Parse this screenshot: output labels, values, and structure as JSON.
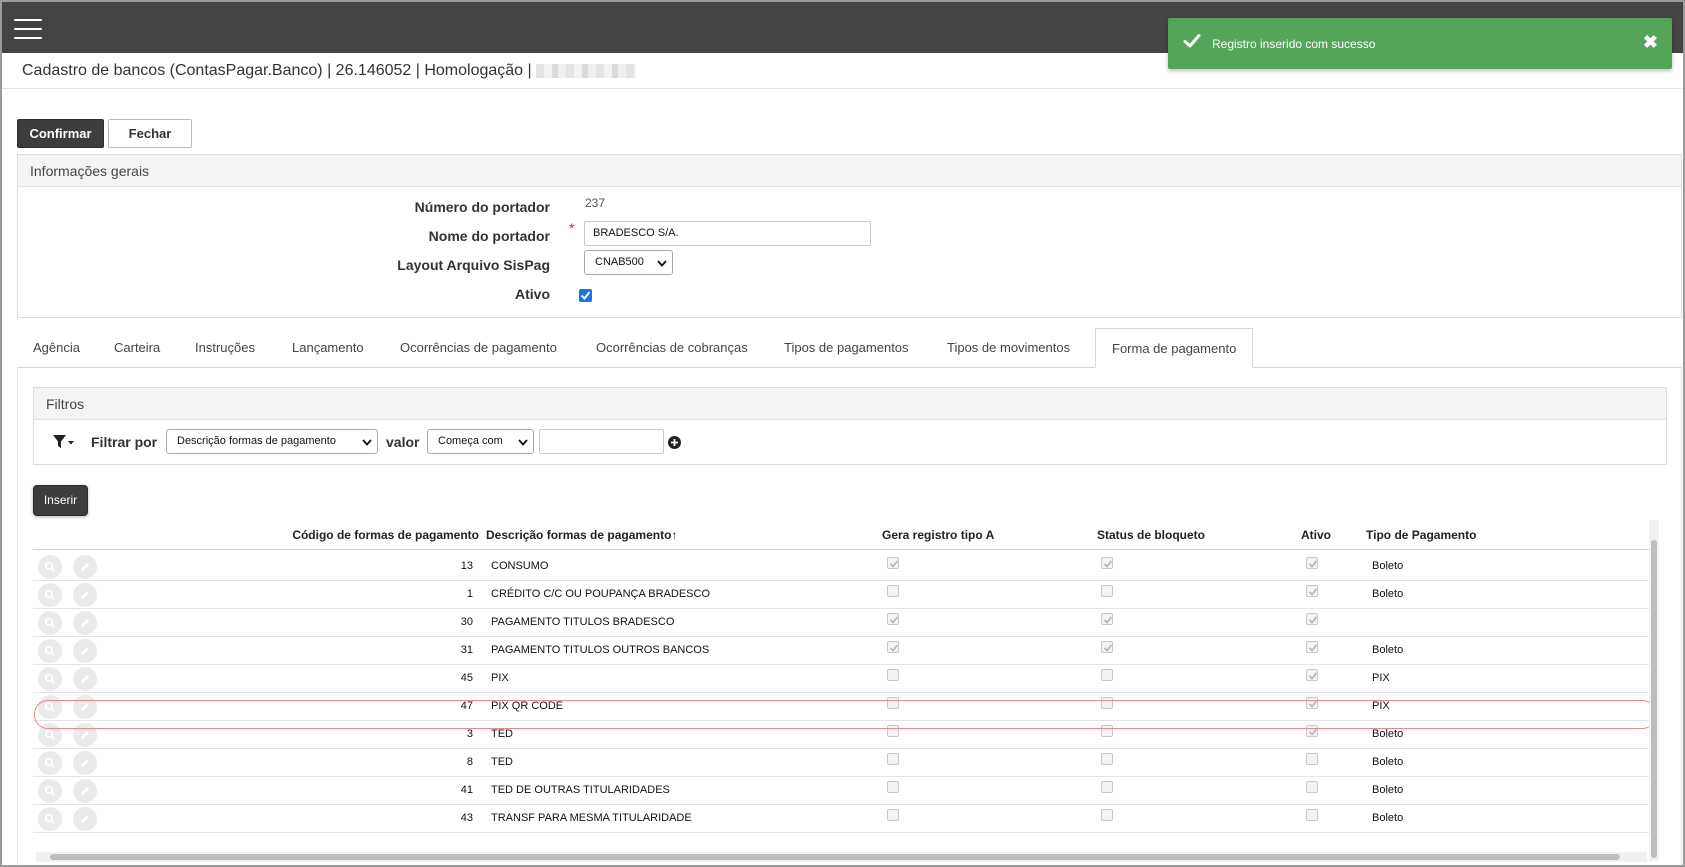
{
  "toast": {
    "message": "Registro inserido com sucesso",
    "color": "#55a558"
  },
  "header": {
    "title": "Cadastro de bancos (ContasPagar.Banco) | 26.146052 | Homologação |",
    "menu_icon": "hamburger-menu-icon"
  },
  "toolbar": {
    "confirm_label": "Confirmar",
    "close_label": "Fechar"
  },
  "general": {
    "title": "Informações gerais",
    "numero_label": "Número do portador",
    "numero_value": "237",
    "nome_label": "Nome do portador",
    "required_mark": "*",
    "nome_value": "BRADESCO S/A.",
    "layout_label": "Layout Arquivo SisPag",
    "layout_value": "CNAB500",
    "ativo_label": "Ativo",
    "ativo_checked": true
  },
  "tabs": [
    {
      "label": "Agência"
    },
    {
      "label": "Carteira"
    },
    {
      "label": "Instruções"
    },
    {
      "label": "Lançamento"
    },
    {
      "label": "Ocorrências de pagamento"
    },
    {
      "label": "Ocorrências de cobranças"
    },
    {
      "label": "Tipos de pagamentos"
    },
    {
      "label": "Tipos de movimentos"
    },
    {
      "label": "Forma de pagamento",
      "active": true
    }
  ],
  "filters": {
    "title": "Filtros",
    "filter_by_label": "Filtrar por",
    "field_value": "Descrição formas de pagamento",
    "valor_label": "valor",
    "operator_value": "Começa com",
    "text_value": ""
  },
  "insert_label": "Inserir",
  "table": {
    "columns": [
      "Código de formas de pagamento",
      "Descrição formas de pagamento",
      "Gera registro tipo A",
      "Status de bloqueto",
      "Ativo",
      "Tipo de Pagamento"
    ],
    "sort_indicator": "↑",
    "rows": [
      {
        "codigo": "13",
        "descricao": "CONSUMO",
        "gera": true,
        "status": true,
        "ativo": true,
        "tipo": "Boleto"
      },
      {
        "codigo": "1",
        "descricao": "CRÉDITO C/C OU POUPANÇA BRADESCO",
        "gera": false,
        "status": false,
        "ativo": true,
        "tipo": "Boleto"
      },
      {
        "codigo": "30",
        "descricao": "PAGAMENTO TITULOS BRADESCO",
        "gera": true,
        "status": true,
        "ativo": true,
        "tipo": ""
      },
      {
        "codigo": "31",
        "descricao": "PAGAMENTO TITULOS OUTROS BANCOS",
        "gera": true,
        "status": true,
        "ativo": true,
        "tipo": "Boleto"
      },
      {
        "codigo": "45",
        "descricao": "PIX",
        "gera": false,
        "status": false,
        "ativo": true,
        "tipo": "PIX"
      },
      {
        "codigo": "47",
        "descricao": "PIX QR CODE",
        "gera": false,
        "status": false,
        "ativo": true,
        "tipo": "PIX",
        "highlighted": true
      },
      {
        "codigo": "3",
        "descricao": "TED",
        "gera": false,
        "status": false,
        "ativo": true,
        "tipo": "Boleto"
      },
      {
        "codigo": "8",
        "descricao": "TED",
        "gera": false,
        "status": false,
        "ativo": false,
        "tipo": "Boleto"
      },
      {
        "codigo": "41",
        "descricao": "TED DE OUTRAS TITULARIDADES",
        "gera": false,
        "status": false,
        "ativo": false,
        "tipo": "Boleto"
      },
      {
        "codigo": "43",
        "descricao": "TRANSF PARA MESMA TITULARIDADE",
        "gera": false,
        "status": false,
        "ativo": false,
        "tipo": "Boleto"
      }
    ]
  },
  "colors": {
    "topbar": "#444444",
    "highlight": "#e58c8c",
    "checkbox_blue": "#1a73e8"
  }
}
